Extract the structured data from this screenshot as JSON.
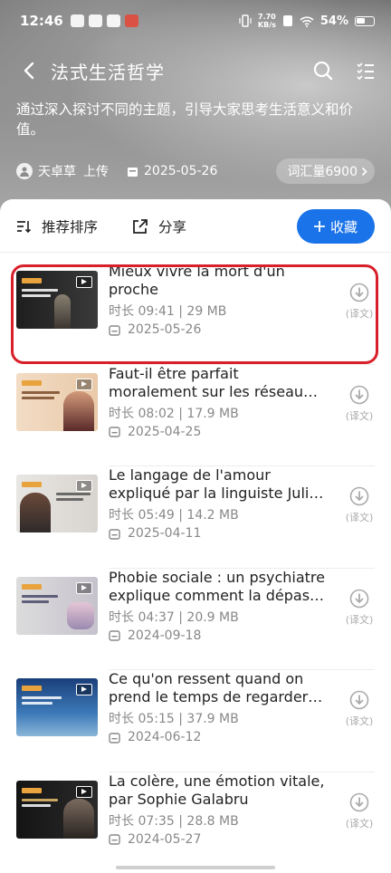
{
  "status": {
    "time": "12:46",
    "net_speed_top": "7.70",
    "net_speed_bottom": "KB/s",
    "battery": "54%"
  },
  "header": {
    "title": "法式生活哲学",
    "description": "通过深入探讨不同的主题，引导大家思考生活意义和价值。",
    "uploader": "天卓草",
    "uploaded_label": "上传",
    "date": "2025-05-26",
    "vocab": "词汇量6900"
  },
  "toolbar": {
    "sort_label": "推荐排序",
    "share_label": "分享",
    "fav_label": "收藏"
  },
  "videos": [
    {
      "title_line1": "Mieux vivre la mort d'un",
      "title_line2": "proche",
      "info": "时长 09:41 | 29 MB",
      "date": "2025-05-26",
      "dl_label": "(译文)"
    },
    {
      "title_line1": "Faut-il être parfait",
      "title_line2": "moralement sur les réseaux …",
      "info": "时长 08:02 | 17.9 MB",
      "date": "2025-04-25",
      "dl_label": "(译文)"
    },
    {
      "title_line1": "Le langage de l'amour",
      "title_line2": "expliqué par la linguiste Juli…",
      "info": "时长 05:49 | 14.2 MB",
      "date": "2025-04-11",
      "dl_label": "(译文)"
    },
    {
      "title_line1": "Phobie sociale : un psychiatre",
      "title_line2": "explique comment la dépasser",
      "info": "时长 04:37 | 20.9 MB",
      "date": "2024-09-18",
      "dl_label": "(译文)"
    },
    {
      "title_line1": "Ce qu'on ressent quand on",
      "title_line2": "prend le temps de regarder …",
      "info": "时长 05:15 | 37.9 MB",
      "date": "2024-06-12",
      "dl_label": "(译文)"
    },
    {
      "title_line1": "La colère, une émotion vitale,",
      "title_line2": "par Sophie Galabru",
      "info": "时长 07:35 | 28.8 MB",
      "date": "2024-05-27",
      "dl_label": "(译文)"
    }
  ],
  "colors": {
    "accent": "#1a73e8",
    "highlight": "#d8202a"
  }
}
